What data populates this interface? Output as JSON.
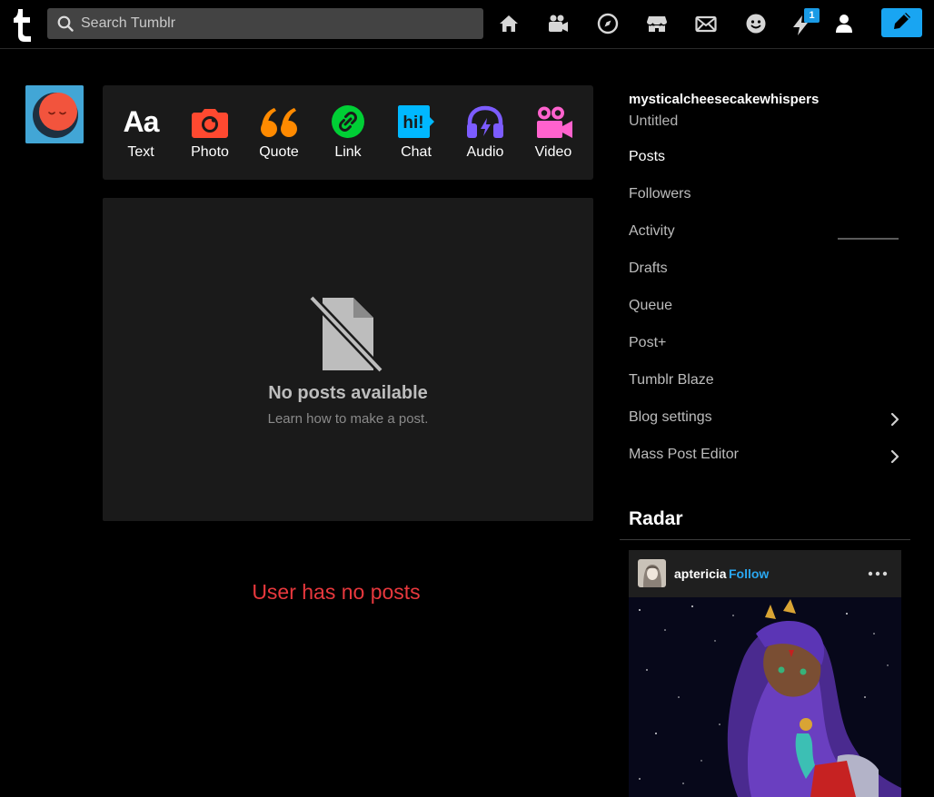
{
  "search": {
    "placeholder": "Search Tumblr"
  },
  "nav": {
    "icons": [
      "tumblr-logo-icon",
      "home-icon",
      "video-camera-icon",
      "explore-compass-icon",
      "shop-icon",
      "mail-icon",
      "face-icon",
      "activity-bolt-icon",
      "account-person-icon",
      "compose-pencil-icon"
    ],
    "notification_count": "1"
  },
  "post_types": [
    {
      "label": "Text",
      "icon": "text-aa-icon",
      "color": "#ffffff"
    },
    {
      "label": "Photo",
      "icon": "photo-camera-icon",
      "color": "#ff4930"
    },
    {
      "label": "Quote",
      "icon": "quote-icon",
      "color": "#ff8a00"
    },
    {
      "label": "Link",
      "icon": "link-icon",
      "color": "#00cf35"
    },
    {
      "label": "Chat",
      "icon": "chat-icon",
      "color": "#00b8ff"
    },
    {
      "label": "Audio",
      "icon": "audio-headphones-icon",
      "color": "#7c5cff"
    },
    {
      "label": "Video",
      "icon": "video-camera-icon",
      "color": "#ff62ce"
    }
  ],
  "empty_state": {
    "title": "No posts available",
    "subtitle": "Learn how to make a post."
  },
  "user_message": "User has no posts",
  "sidebar": {
    "blog_name": "mysticalcheesecakewhispers",
    "blog_title": "Untitled",
    "items": [
      {
        "label": "Posts",
        "active": true
      },
      {
        "label": "Followers"
      },
      {
        "label": "Activity"
      },
      {
        "label": "Drafts"
      },
      {
        "label": "Queue"
      },
      {
        "label": "Post+"
      },
      {
        "label": "Tumblr Blaze"
      },
      {
        "label": "Blog settings",
        "has_chevron": true
      },
      {
        "label": "Mass Post Editor",
        "has_chevron": true
      }
    ]
  },
  "radar": {
    "title": "Radar",
    "username": "aptericia",
    "follow_label": "Follow"
  },
  "colors": {
    "accent": "#19a5f2",
    "error": "#e8383d",
    "panel": "#1a1a1a"
  }
}
